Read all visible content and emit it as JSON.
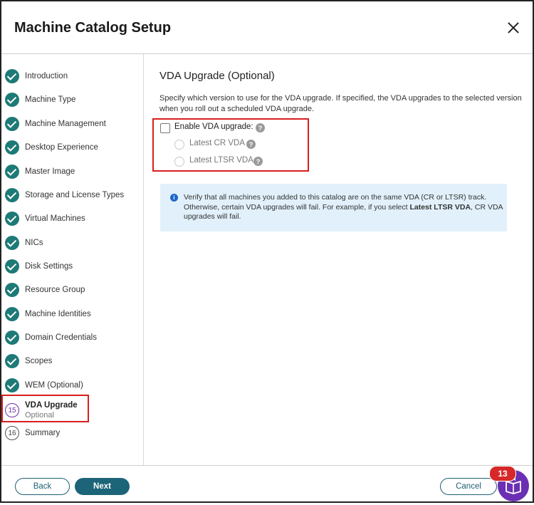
{
  "dialog": {
    "title": "Machine Catalog Setup"
  },
  "sidebar": {
    "completed_steps": [
      "Introduction",
      "Machine Type",
      "Machine Management",
      "Desktop Experience",
      "Master Image",
      "Storage and License Types",
      "Virtual Machines",
      "NICs",
      "Disk Settings",
      "Resource Group",
      "Machine Identities",
      "Domain Credentials",
      "Scopes",
      "WEM (Optional)"
    ],
    "active_step": {
      "number": "15",
      "label": "VDA Upgrade",
      "sub": "Optional"
    },
    "next_step": {
      "number": "16",
      "label": "Summary"
    }
  },
  "content": {
    "title": "VDA Upgrade (Optional)",
    "description": "Specify which version to use for the VDA upgrade. If specified, the VDA upgrades to the selected version when you roll out a scheduled VDA upgrade.",
    "enable_checkbox_label": "Enable VDA upgrade:",
    "options": [
      "Latest CR VDA",
      "Latest LTSR VDA"
    ],
    "help_glyph": "?",
    "info": {
      "icon": "i",
      "text_1": "Verify that all machines you added to this catalog are on the same VDA (CR or LTSR) track. Otherwise, certain VDA upgrades will fail. For example, if you select ",
      "text_bold": "Latest LTSR VDA",
      "text_2": ", CR VDA upgrades will fail."
    }
  },
  "footer": {
    "back": "Back",
    "next": "Next",
    "cancel": "Cancel",
    "notification_count": "13"
  },
  "colors": {
    "check": "#1e7a76",
    "active_step": "#6b2fa8",
    "highlight": "#d81e1e",
    "info_bg": "#e1f0fa",
    "primary_button": "#1c6478"
  }
}
